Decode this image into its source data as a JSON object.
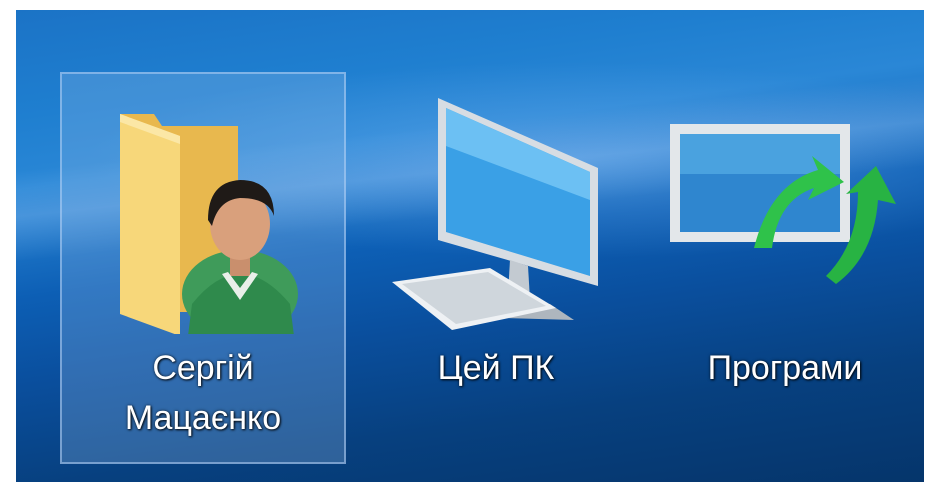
{
  "desktop": {
    "icons": [
      {
        "label_line1": "Сергій",
        "label_line2": "Мацаєнко",
        "icon": "user-folder-icon",
        "selected": true
      },
      {
        "label_line1": "Цей ПК",
        "icon": "computer-icon",
        "selected": false
      },
      {
        "label_line1": "Програми",
        "icon": "programs-sync-icon",
        "selected": false
      }
    ]
  },
  "colors": {
    "folder": "#f5cf6b",
    "user_shirt": "#3f9b5a",
    "monitor_screen": "#3aa0e6",
    "arrow_green": "#2fc24a"
  }
}
